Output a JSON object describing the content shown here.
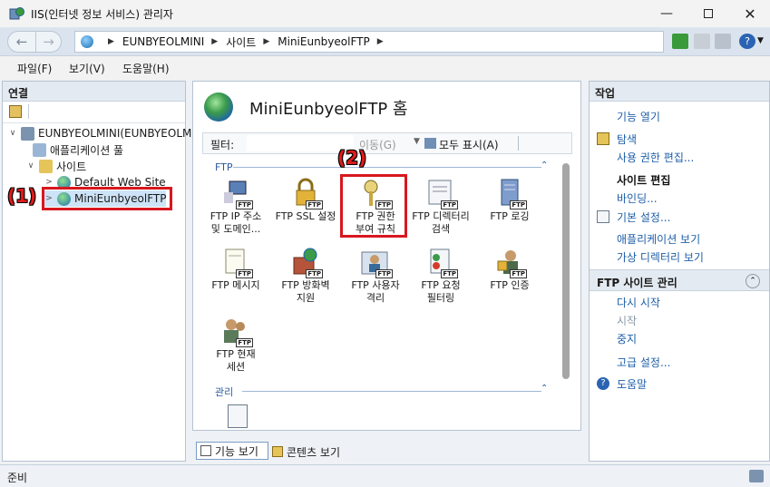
{
  "window": {
    "title": "IIS(인터넷 정보 서비스) 관리자",
    "controls": [
      "minimize",
      "maximize",
      "close"
    ]
  },
  "address": {
    "crumbs": [
      "EUNBYEOLMINI",
      "사이트",
      "MiniEunbyeolFTP"
    ]
  },
  "menu": [
    "파일(F)",
    "보기(V)",
    "도움말(H)"
  ],
  "connections": {
    "header": "연결",
    "tree": [
      {
        "label": "EUNBYEOLMINI(EUNBYEOLMINI",
        "level": 0
      },
      {
        "label": "애플리케이션 풀",
        "level": 1
      },
      {
        "label": "사이트",
        "level": 1
      },
      {
        "label": "Default Web Site",
        "level": 2
      },
      {
        "label": "MiniEunbyeolFTP",
        "level": 2
      }
    ]
  },
  "main": {
    "title": "MiniEunbyeolFTP 홈",
    "filter_label": "필터:",
    "go_label": "이동(G)",
    "show_all_label": "모두 표시(A)",
    "section_ftp": "FTP",
    "section_manage": "관리",
    "features": [
      {
        "line1": "FTP IP 주소",
        "line2": "및 도메인..."
      },
      {
        "line1": "FTP SSL 설정",
        "line2": ""
      },
      {
        "line1": "FTP 권한",
        "line2": "부여 규칙"
      },
      {
        "line1": "FTP 디렉터리",
        "line2": "검색"
      },
      {
        "line1": "FTP 로깅",
        "line2": ""
      },
      {
        "line1": "FTP 메시지",
        "line2": ""
      },
      {
        "line1": "FTP 방화벽",
        "line2": "지원"
      },
      {
        "line1": "FTP 사용자",
        "line2": "격리"
      },
      {
        "line1": "FTP 요청",
        "line2": "필터링"
      },
      {
        "line1": "FTP 인증",
        "line2": ""
      },
      {
        "line1": "FTP 현재",
        "line2": "세션"
      }
    ],
    "view_tabs": [
      "기능 보기",
      "콘텐츠 보기"
    ]
  },
  "actions": {
    "header": "작업",
    "open_feature": "기능 열기",
    "explore": "탐색",
    "edit_permissions": "사용 권한 편집...",
    "site_edit_header": "사이트 편집",
    "bindings": "바인딩...",
    "basic_settings": "기본 설정...",
    "view_apps": "애플리케이션 보기",
    "view_vdirs": "가상 디렉터리 보기",
    "ftp_manage_header": "FTP 사이트 관리",
    "restart": "다시 시작",
    "start": "시작",
    "stop": "중지",
    "advanced": "고급 설정...",
    "help": "도움말"
  },
  "status": {
    "text": "준비"
  },
  "annotations": {
    "one": "(1)",
    "two": "(2)"
  },
  "colors": {
    "accent": "#1e5fa8",
    "annotation": "#d8171f"
  }
}
